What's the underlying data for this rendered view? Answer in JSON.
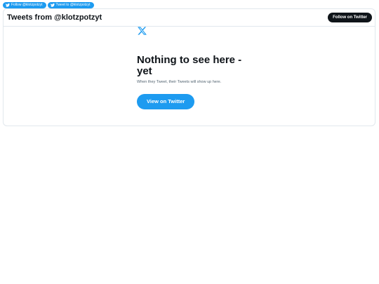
{
  "top_buttons": {
    "follow_label": "Follow @klotzpotzyt",
    "tweet_label": "Tweet to @klotzpotzyt"
  },
  "timeline": {
    "title": "Tweets from @klotzpotzyt",
    "follow_button": "Follow on Twitter",
    "empty_title": "Nothing to see here - yet",
    "empty_subtitle": "When they Tweet, their Tweets will show up here.",
    "view_button": "View on Twitter"
  },
  "colors": {
    "accent": "#1d9bf0",
    "dark": "#0f1419",
    "muted": "#536471",
    "border": "#e1e8ed"
  },
  "icons": {
    "bird": "twitter-bird-icon",
    "logo": "x-logo-icon"
  }
}
